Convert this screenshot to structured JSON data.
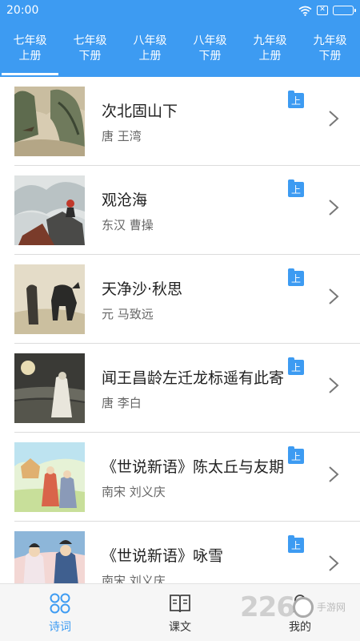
{
  "status_bar": {
    "time": "20:00"
  },
  "tabs": [
    {
      "line1": "七年级",
      "line2": "上册"
    },
    {
      "line1": "七年级",
      "line2": "下册"
    },
    {
      "line1": "八年级",
      "line2": "上册"
    },
    {
      "line1": "八年级",
      "line2": "下册"
    },
    {
      "line1": "九年级",
      "line2": "上册"
    },
    {
      "line1": "九年级",
      "line2": "下册"
    }
  ],
  "active_tab": 0,
  "poems": [
    {
      "title": "次北固山下",
      "author": "唐 王湾",
      "badge": "上"
    },
    {
      "title": "观沧海",
      "author": "东汉 曹操",
      "badge": "上"
    },
    {
      "title": "天净沙·秋思",
      "author": "元 马致远",
      "badge": "上"
    },
    {
      "title": "闻王昌龄左迁龙标遥有此寄",
      "author": "唐 李白",
      "badge": "上"
    },
    {
      "title": "《世说新语》陈太丘与友期",
      "author": "南宋 刘义庆",
      "badge": "上"
    },
    {
      "title": "《世说新语》咏雪",
      "author": "南宋 刘义庆",
      "badge": "上"
    }
  ],
  "bottom_nav": [
    {
      "label": "诗词",
      "icon": "grid-icon"
    },
    {
      "label": "课文",
      "icon": "book-icon"
    },
    {
      "label": "我的",
      "icon": "person-icon"
    }
  ],
  "watermark": {
    "number": "226",
    "text": "手游网"
  },
  "colors": {
    "accent": "#3d9bf2"
  }
}
